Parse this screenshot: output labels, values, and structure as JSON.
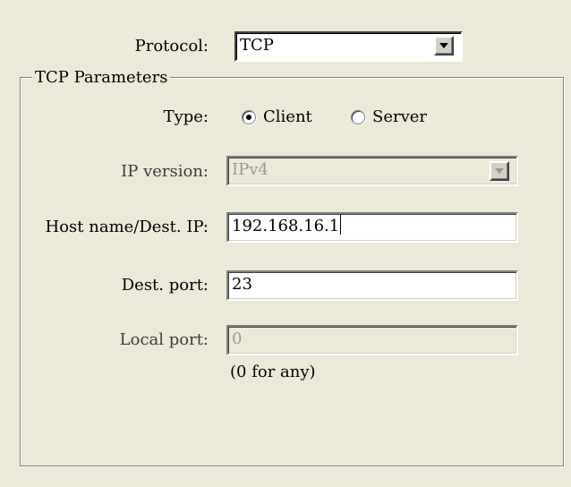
{
  "protocol": {
    "label": "Protocol:",
    "value": "TCP"
  },
  "group": {
    "title": "TCP Parameters"
  },
  "type": {
    "label": "Type:",
    "options": [
      {
        "label": "Client",
        "checked": true
      },
      {
        "label": "Server",
        "checked": false
      }
    ]
  },
  "ip_version": {
    "label": "IP version:",
    "value": "IPv4",
    "enabled": false
  },
  "host": {
    "label": "Host name/Dest. IP:",
    "value": "192.168.16.1"
  },
  "dest_port": {
    "label": "Dest. port:",
    "value": "23"
  },
  "local_port": {
    "label": "Local port:",
    "value": "0",
    "enabled": false,
    "hint": "(0 for any)"
  }
}
